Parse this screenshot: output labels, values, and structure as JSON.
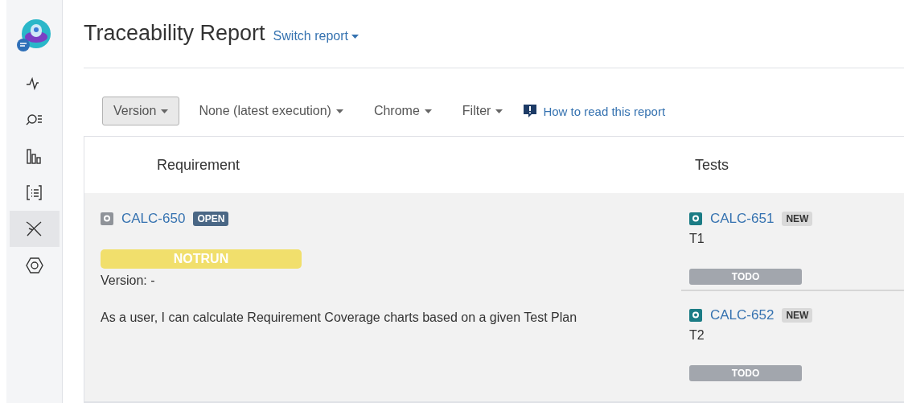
{
  "sidebar": {
    "items": [
      {
        "kind": "activity",
        "selected": false
      },
      {
        "kind": "search",
        "selected": false
      },
      {
        "kind": "bars",
        "selected": false
      },
      {
        "kind": "list",
        "selected": false
      },
      {
        "kind": "cross",
        "selected": true
      },
      {
        "kind": "hexagon",
        "selected": false
      }
    ]
  },
  "header": {
    "title": "Traceability Report",
    "switch": "Switch report"
  },
  "toolbar": {
    "filters": [
      {
        "label": "Version",
        "selected": true
      },
      {
        "label": "None (latest execution)",
        "selected": false
      },
      {
        "label": "Chrome",
        "selected": false
      },
      {
        "label": "Filter",
        "selected": false
      }
    ],
    "help_link": "How to read this report"
  },
  "table": {
    "columns": [
      "Requirement",
      "Tests"
    ],
    "rows": [
      {
        "requirement": {
          "key": "CALC-650",
          "status": "OPEN",
          "result": "NOTRUN",
          "color": "#f1df6c",
          "version": "Version: -",
          "summary": "As a user, I can calculate Requirement Coverage charts based on a given Test Plan"
        },
        "tests": [
          {
            "key": "CALC-651",
            "status": "NEW",
            "name": "T1",
            "result": "TODO"
          },
          {
            "key": "CALC-652",
            "status": "NEW",
            "name": "T2",
            "result": "TODO"
          }
        ]
      }
    ]
  }
}
